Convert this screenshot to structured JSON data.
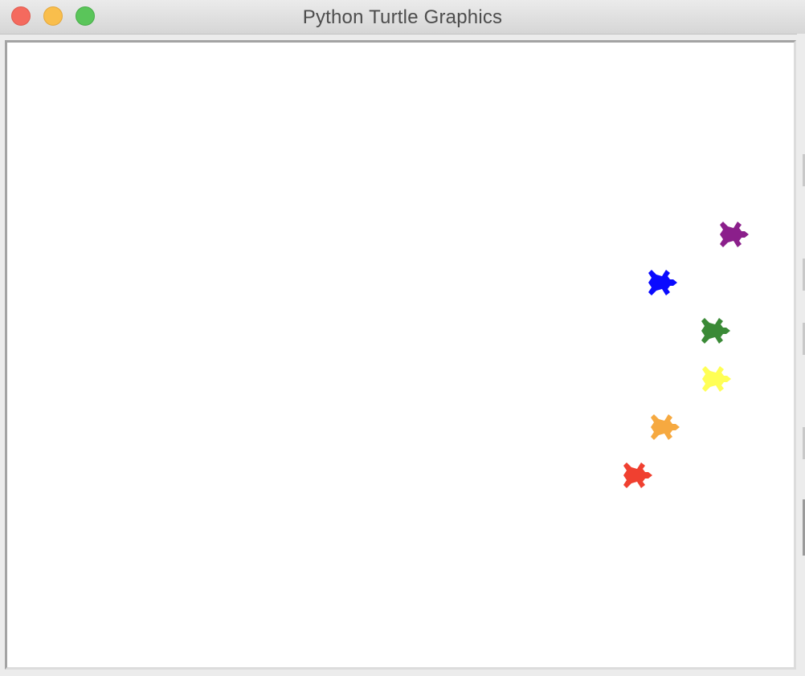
{
  "window": {
    "title": "Python Turtle Graphics",
    "controls": [
      "close",
      "minimize",
      "zoom"
    ]
  },
  "turtles": [
    {
      "name": "purple-turtle",
      "color": "#8b1f8b"
    },
    {
      "name": "blue-turtle",
      "color": "#0a0aff"
    },
    {
      "name": "green-turtle",
      "color": "#3a8a36"
    },
    {
      "name": "yellow-turtle",
      "color": "#ffff55"
    },
    {
      "name": "orange-turtle",
      "color": "#f6a940"
    },
    {
      "name": "red-turtle",
      "color": "#f04030"
    }
  ]
}
